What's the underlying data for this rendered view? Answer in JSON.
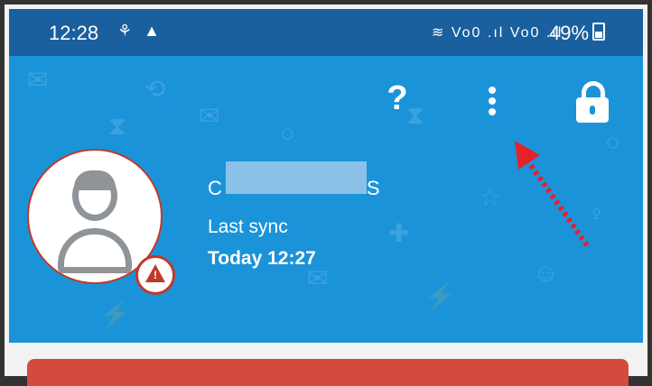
{
  "status_bar": {
    "time": "12:28",
    "left_icons": "⚘ ▲",
    "network": "Vo0 .ıl Vo0 .ıl",
    "battery": "49%"
  },
  "header": {
    "help_label": "?",
    "user": {
      "name_prefix": "C",
      "name_suffix": "S",
      "last_sync_label": "Last sync",
      "last_sync_value": "Today 12:27"
    }
  },
  "colors": {
    "header_bg": "#1b93d9",
    "status_bg": "#1a5f9e",
    "accent_red": "#c0392b",
    "arrow_red": "#e8202a"
  },
  "icons": [
    "help-icon",
    "more-vert-icon",
    "lock-icon",
    "user-avatar-icon",
    "warning-icon",
    "wifi-icon",
    "signal-icon",
    "battery-icon"
  ]
}
